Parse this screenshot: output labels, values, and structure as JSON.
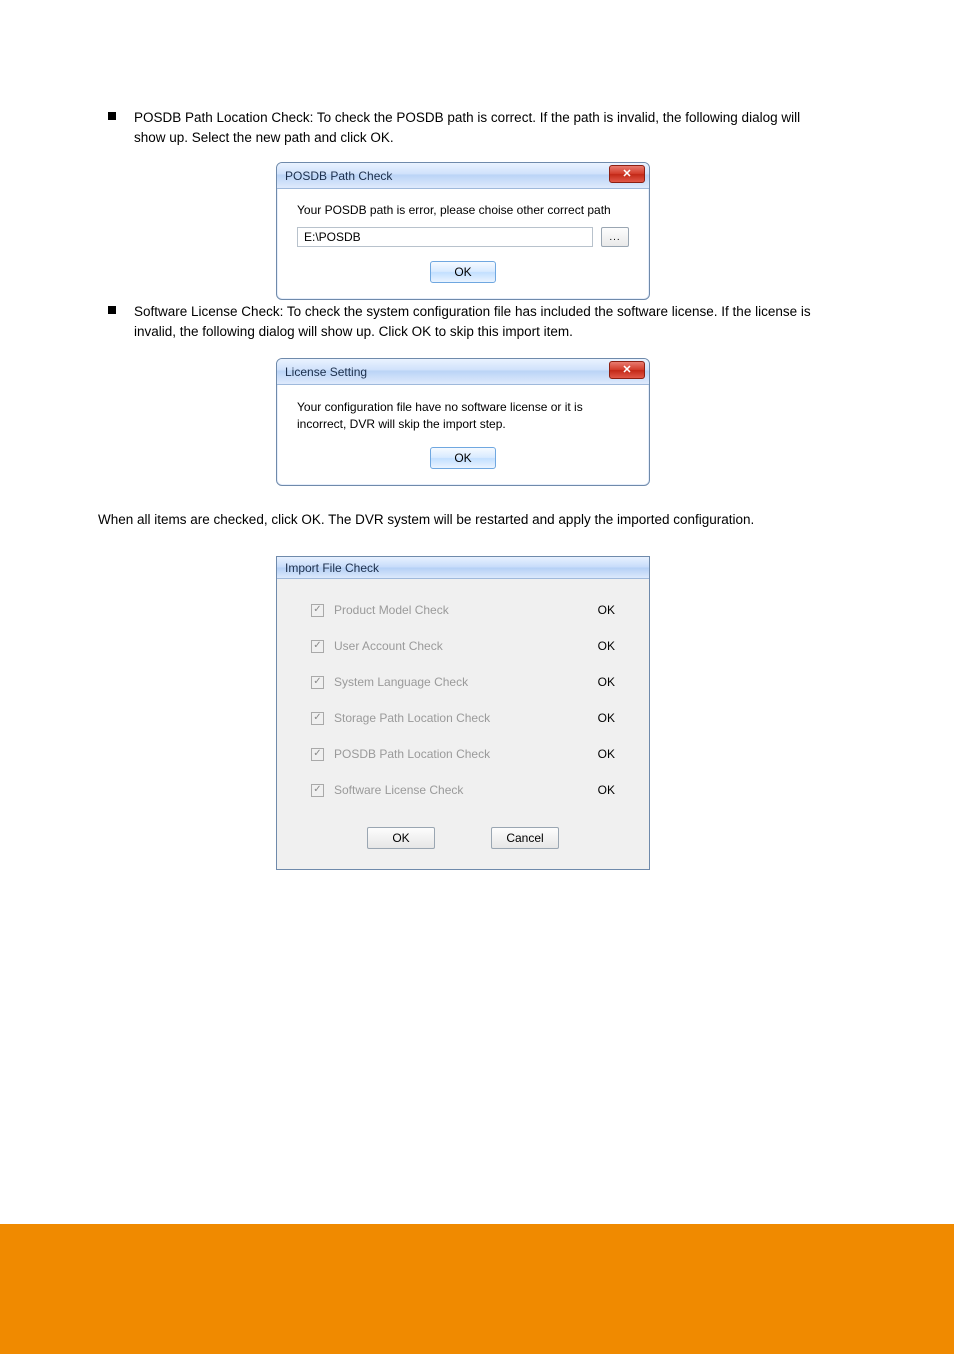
{
  "bullets": {
    "posdb": "POSDB Path Location Check: To check the POSDB path is correct. If the path is invalid, the following dialog will show up. Select the new path and click OK.",
    "license": "Software License Check: To check the system configuration file has included the software license. If the license is invalid, the following dialog will show up. Click OK to skip this import item."
  },
  "dialog1": {
    "title": "POSDB Path Check",
    "message": "Your POSDB path is error, please choise other correct path",
    "path_value": "E:\\POSDB",
    "browse_label": "...",
    "ok": "OK"
  },
  "dialog2": {
    "title": "License Setting",
    "message": "Your configuration file have no software license or it is incorrect, DVR will skip the import step.",
    "ok": "OK"
  },
  "footer_text": "When all items are checked, click OK. The DVR system will be restarted and apply the imported configuration.",
  "dialog3": {
    "title": "Import File Check",
    "rows": [
      {
        "label": "Product Model Check",
        "status": "OK"
      },
      {
        "label": "User Account Check",
        "status": "OK"
      },
      {
        "label": "System Language Check",
        "status": "OK"
      },
      {
        "label": "Storage Path Location Check",
        "status": "OK"
      },
      {
        "label": "POSDB Path Location Check",
        "status": "OK"
      },
      {
        "label": "Software License Check",
        "status": "OK"
      }
    ],
    "ok": "OK",
    "cancel": "Cancel"
  }
}
